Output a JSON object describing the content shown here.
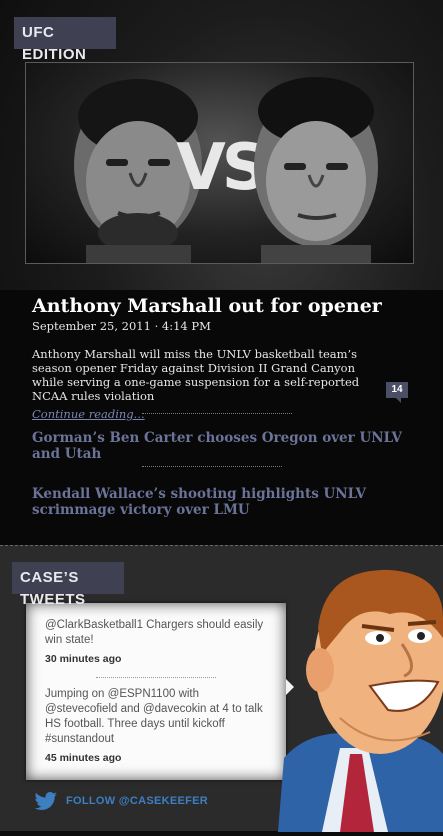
{
  "colors": {
    "accent_badge": "#3f4152",
    "link": "#7c86b0",
    "headline_link": "#6b7398",
    "twitter_blue": "#3d7fc1"
  },
  "ufc": {
    "badge_label": "UFC Edition"
  },
  "hero": {
    "vs_text": "VS",
    "image": "fighters-faceoff-image"
  },
  "article": {
    "title": "Anthony Marshall out for opener",
    "date": "September 25, 2011 · 4:14 PM",
    "body": "Anthony Marshall will miss the UNLV basketball team’s season opener Friday against Division II Grand Canyon while serving a one-game suspension for a self-reported NCAA rules violation",
    "continue_label": "Continue reading...",
    "comment_count": "14"
  },
  "headlines": [
    {
      "text": "Gorman’s Ben Carter chooses Oregon over UNLV and Utah"
    },
    {
      "text": "Kendall Wallace’s shooting highlights UNLV scrimmage victory over LMU"
    }
  ],
  "tweets_section": {
    "badge_label": "Case’s Tweets",
    "tweets": [
      {
        "text": "@ClarkBasketball1 Chargers should easily win state!",
        "time": "30 minutes ago"
      },
      {
        "text": "Jumping on @ESPN1100 with @stevecofield and @davecokin at 4 to talk HS football. Three days until kickoff #sunstandout",
        "time": "45 minutes ago"
      }
    ],
    "follow_label": "Follow @CaseKeefer",
    "follow_icon": "twitter-bird-icon"
  }
}
